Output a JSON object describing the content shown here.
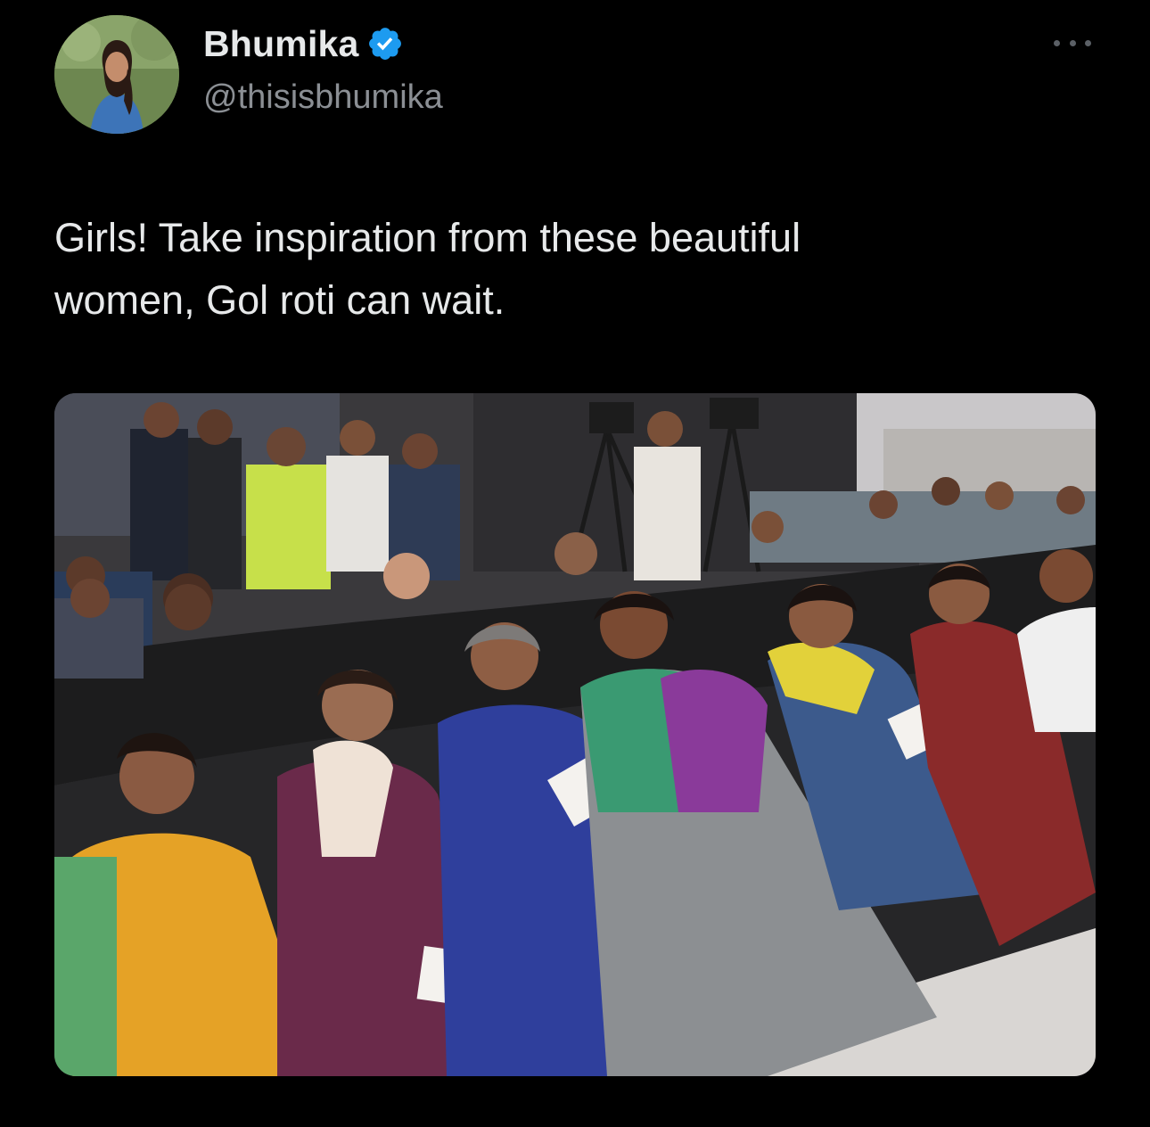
{
  "tweet": {
    "author": {
      "display_name": "Bhumika",
      "handle": "@thisisbhumika",
      "verified": true,
      "avatar_icon": "profile-photo"
    },
    "menu_icon": "more-options-icon",
    "text": "Girls! Take inspiration from these beautiful\nwomen, Gol roti can wait.",
    "media": {
      "kind": "photo",
      "alt_icon": "audience-photo"
    }
  },
  "colors": {
    "background": "#000000",
    "text_primary": "#e7e9ea",
    "text_secondary": "#8b8f94",
    "verified_badge": "#1d9bf0"
  }
}
